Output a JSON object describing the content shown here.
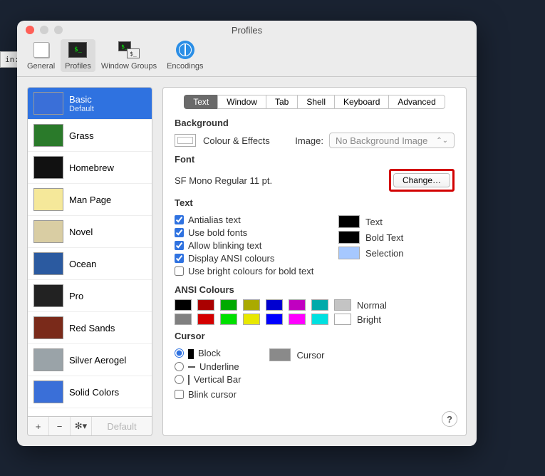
{
  "desk_fragment": "in:\nac:",
  "window": {
    "title": "Profiles"
  },
  "toolbar": {
    "items": [
      {
        "label": "General"
      },
      {
        "label": "Profiles"
      },
      {
        "label": "Window Groups"
      },
      {
        "label": "Encodings"
      }
    ],
    "active_index": 1
  },
  "sidebar": {
    "profiles": [
      {
        "name": "Basic",
        "subtitle": "Default",
        "thumb_bg": "#3a6fd8",
        "selected": true
      },
      {
        "name": "Grass",
        "thumb_bg": "#2a7a2a"
      },
      {
        "name": "Homebrew",
        "thumb_bg": "#111111"
      },
      {
        "name": "Man Page",
        "thumb_bg": "#f5e89a"
      },
      {
        "name": "Novel",
        "thumb_bg": "#d9cda3"
      },
      {
        "name": "Ocean",
        "thumb_bg": "#2b5aa0"
      },
      {
        "name": "Pro",
        "thumb_bg": "#222222"
      },
      {
        "name": "Red Sands",
        "thumb_bg": "#7a2a1a"
      },
      {
        "name": "Silver Aerogel",
        "thumb_bg": "#9aa3a8"
      },
      {
        "name": "Solid Colors",
        "thumb_bg": "#3a6fd8"
      }
    ],
    "footer": {
      "add": "+",
      "remove": "−",
      "gear": "✻▾",
      "default_btn": "Default"
    }
  },
  "tabs": {
    "items": [
      "Text",
      "Window",
      "Tab",
      "Shell",
      "Keyboard",
      "Advanced"
    ],
    "active_index": 0
  },
  "background": {
    "heading": "Background",
    "colour_effects_label": "Colour & Effects",
    "image_label": "Image:",
    "image_select_value": "No Background Image"
  },
  "font": {
    "heading": "Font",
    "current": "SF Mono Regular 11 pt.",
    "change_label": "Change…"
  },
  "text": {
    "heading": "Text",
    "checks": [
      {
        "label": "Antialias text",
        "checked": true
      },
      {
        "label": "Use bold fonts",
        "checked": true
      },
      {
        "label": "Allow blinking text",
        "checked": true
      },
      {
        "label": "Display ANSI colours",
        "checked": true
      },
      {
        "label": "Use bright colours for bold text",
        "checked": false
      }
    ],
    "swatches": [
      {
        "label": "Text",
        "color": "#000000"
      },
      {
        "label": "Bold Text",
        "color": "#000000"
      },
      {
        "label": "Selection",
        "color": "#a6c8ff"
      }
    ]
  },
  "ansi": {
    "heading": "ANSI Colours",
    "rows": [
      {
        "label": "Normal",
        "colors": [
          "#000000",
          "#aa0000",
          "#00aa00",
          "#aaaa00",
          "#0000d0",
          "#c000c0",
          "#00aaaa",
          "#c4c4c4"
        ]
      },
      {
        "label": "Bright",
        "colors": [
          "#808080",
          "#d40000",
          "#00e000",
          "#e8e800",
          "#0000ff",
          "#ff00ff",
          "#00e0e0",
          "#ffffff"
        ]
      }
    ]
  },
  "cursor": {
    "heading": "Cursor",
    "options": [
      {
        "label": "Block",
        "selected": true
      },
      {
        "label": "Underline",
        "selected": false
      },
      {
        "label": "Vertical Bar",
        "selected": false
      }
    ],
    "swatch_label": "Cursor",
    "swatch_color": "#8a8a8a",
    "blink_label": "Blink cursor",
    "blink_checked": false
  },
  "help_label": "?"
}
